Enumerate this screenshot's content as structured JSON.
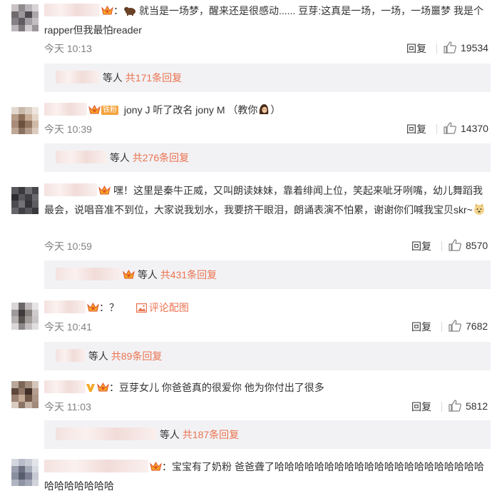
{
  "comments": [
    {
      "text_prefix": "：",
      "text": "就当是一场梦，醒来还是很感动......   豆芽:这真是一场，一场，一场噩梦     我是个rapper但我最怕reader",
      "time": "今天 10:13",
      "reply_label": "回复",
      "likes": "19534",
      "sub_label": "等人",
      "sub_count": "共171条回复",
      "icon": "bear-emoji"
    },
    {
      "badge": "铁粉",
      "text": "jony J 听了改名 jony M （教你",
      "text_suffix": "）",
      "time": "今天 10:39",
      "reply_label": "回复",
      "likes": "14370",
      "sub_label": "等人",
      "sub_count": "共276条回复",
      "icon": "girl-emoji"
    },
    {
      "text": "嘿！这里是秦牛正威，又叫朗读妹妹，靠着绯闻上位，笑起来呲牙咧嘴，幼儿舞蹈我最会，说唱音准不到位，大家说我划水，我要挤干眼泪，朗诵表演不怕累，谢谢你们喊我宝贝skr~",
      "time": "今天 10:59",
      "reply_label": "回复",
      "likes": "8570",
      "sub_label": "等人",
      "sub_count": "共431条回复",
      "icon": "doge-emoji"
    },
    {
      "text": "？",
      "pic_label": "评论配图",
      "time": "今天 10:41",
      "reply_label": "回复",
      "likes": "7682",
      "sub_label": "等人",
      "sub_count": "共89条回复"
    },
    {
      "text": "豆芽女儿 你爸爸真的很爱你 他为你付出了很多",
      "time": "今天 11:03",
      "reply_label": "回复",
      "likes": "5812",
      "sub_label": "等人",
      "sub_count": "共187条回复"
    },
    {
      "text": "宝宝有了奶粉  爸爸聋了哈哈哈哈哈哈哈哈哈哈哈哈哈哈哈哈哈哈哈哈哈哈哈哈哈哈哈哈"
    }
  ],
  "colors": {
    "accent": "#eb7350",
    "link": "#eb7350",
    "subbox_bg": "#f2f2f5",
    "meta": "#808080",
    "divider": "#d9d9d9"
  }
}
